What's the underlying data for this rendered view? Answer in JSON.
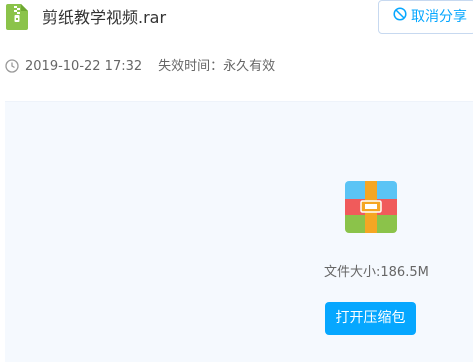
{
  "file": {
    "name": "剪纸教学视频.rar",
    "size_text": "文件大小:186.5M",
    "icon": "zip-file-icon"
  },
  "actions": {
    "cancel_share_label": "取消分享",
    "open_archive_label": "打开压缩包"
  },
  "meta": {
    "timestamp": "2019-10-22 17:32",
    "expire_text": "失效时间：永久有效"
  },
  "colors": {
    "accent": "#06a7ff",
    "panel_bg": "#f5f9fe",
    "zip_green": "#8bc34a",
    "rar_red": "#f05b5b",
    "rar_blue": "#5bc4f5",
    "rar_orange": "#f5a623"
  }
}
